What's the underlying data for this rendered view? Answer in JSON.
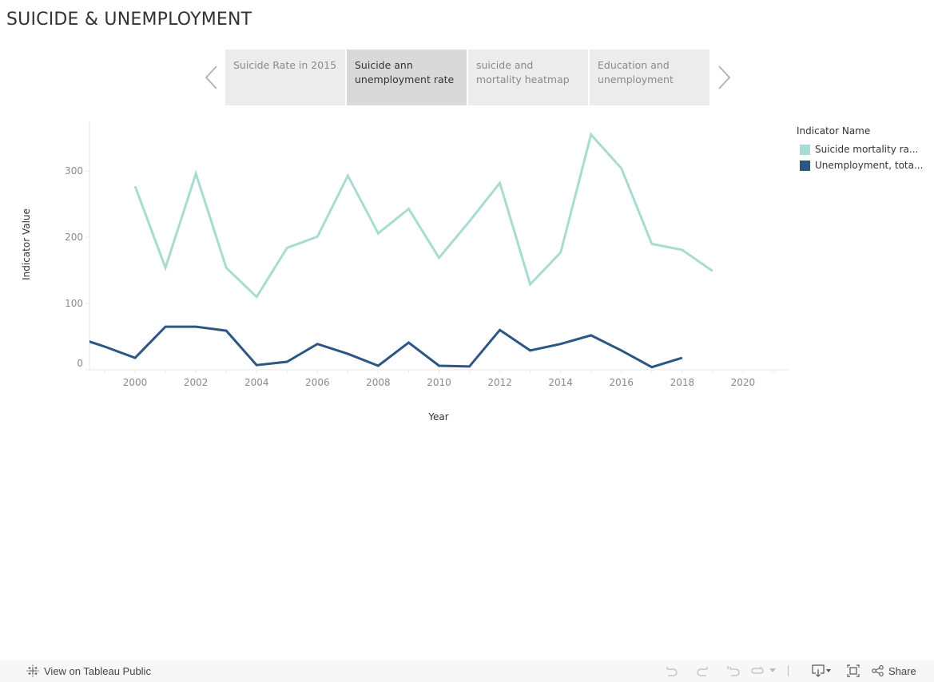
{
  "title": "SUICIDE & UNEMPLOYMENT",
  "tabs": [
    {
      "label": "Suicide Rate in 2015",
      "active": false
    },
    {
      "label": "Suicide ann unemployment rate",
      "active": true
    },
    {
      "label": "suicide and mortality heatmap",
      "active": false
    },
    {
      "label": "Education and unemployment",
      "active": false
    }
  ],
  "nav": {
    "prev_icon": "chevron-left-icon",
    "next_icon": "chevron-right-icon"
  },
  "legend": {
    "title": "Indicator Name",
    "items": [
      {
        "label": "Suicide mortality ra...",
        "color": "#a8dcd3"
      },
      {
        "label": "Unemployment, tota...",
        "color": "#2c5783"
      }
    ]
  },
  "footer": {
    "view_label": "View on Tableau Public",
    "share_label": "Share",
    "icons": [
      "undo-icon",
      "redo-icon",
      "revert-icon",
      "refresh-icon",
      "dropdown-icon",
      "download-icon",
      "fullscreen-icon",
      "share-icon"
    ]
  },
  "chart_data": {
    "type": "line",
    "title": "",
    "xlabel": "Year",
    "ylabel": "Indicator Value",
    "xlim": [
      1998.5,
      2021.5
    ],
    "ylim": [
      0,
      375
    ],
    "x_ticks": [
      2000,
      2002,
      2004,
      2006,
      2008,
      2010,
      2012,
      2014,
      2016,
      2018,
      2020
    ],
    "y_ticks": [
      0,
      100,
      200,
      300
    ],
    "grid": false,
    "legend_position": "top-right",
    "series": [
      {
        "name": "Suicide mortality ra...",
        "color": "#a8dcd3",
        "x": [
          2000,
          2001,
          2002,
          2003,
          2004,
          2005,
          2006,
          2007,
          2008,
          2009,
          2010,
          2011,
          2012,
          2013,
          2014,
          2015,
          2016,
          2017,
          2018,
          2019
        ],
        "values": [
          277,
          154,
          296,
          154,
          110,
          184,
          201,
          293,
          206,
          243,
          169,
          224,
          282,
          129,
          177,
          355,
          304,
          190,
          181,
          149
        ]
      },
      {
        "name": "Unemployment, tota...",
        "color": "#2c5783",
        "x": [
          1998,
          1999,
          2000,
          2001,
          2002,
          2003,
          2004,
          2005,
          2006,
          2007,
          2008,
          2009,
          2010,
          2011,
          2012,
          2013,
          2014,
          2015,
          2016,
          2017,
          2018
        ],
        "values": [
          50,
          35,
          18,
          65,
          65,
          59,
          7,
          12,
          39,
          24,
          6,
          41,
          6,
          5,
          60,
          29,
          39,
          52,
          29,
          4,
          18
        ]
      }
    ]
  }
}
